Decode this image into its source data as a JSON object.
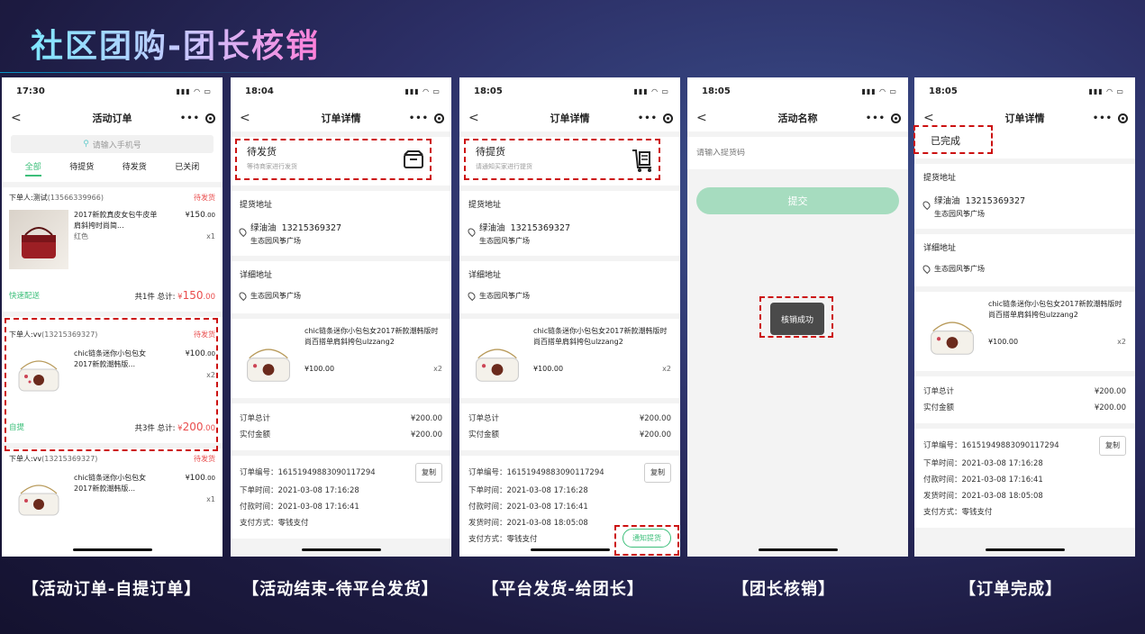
{
  "title": "社区团购-团长核销",
  "captions": [
    "【活动订单-自提订单】",
    "【活动结束-待平台发货】",
    "【平台发货-给团长】",
    "【团长核销】",
    "【订单完成】"
  ],
  "colors": {
    "accent_green": "#3cbf7a",
    "price_red": "#e94c4c",
    "dash_red": "#cc1111"
  },
  "phone1": {
    "time": "17:30",
    "nav_title": "活动订单",
    "search_placeholder": "请输入手机号",
    "tabs": [
      "全部",
      "待提货",
      "待发货",
      "已关闭"
    ],
    "orders": [
      {
        "buyer": "下单人:测试",
        "phone": "(13566339966)",
        "status": "待发货",
        "product": "2017新款真皮女包牛皮单肩斜挎时尚简...",
        "variant": "红色",
        "price_sym": "¥",
        "price_int": "150",
        "price_dec": ".00",
        "qty": "x1",
        "ship": "快速配送",
        "summary": "共1件 总计:",
        "total_sym": "¥",
        "total_int": "150",
        "total_dec": ".00"
      },
      {
        "buyer": "下单人:vv",
        "phone": "(13215369327)",
        "status": "待发货",
        "product": "chic链条迷你小包包女2017新款潮韩版...",
        "variant": "",
        "price_sym": "¥",
        "price_int": "100",
        "price_dec": ".00",
        "qty": "x2",
        "ship": "自提",
        "summary": "共3件 总计:",
        "total_sym": "¥",
        "total_int": "200",
        "total_dec": ".00"
      },
      {
        "buyer": "下单人:vv",
        "phone": "(13215369327)",
        "status": "待发货",
        "product": "chic链条迷你小包包女2017新款潮韩版...",
        "variant": "",
        "price_sym": "¥",
        "price_int": "100",
        "price_dec": ".00",
        "qty": "x1"
      }
    ]
  },
  "phone2": {
    "time": "18:04",
    "nav_title": "订单详情",
    "status_title": "待发货",
    "status_sub": "等待商家进行发货",
    "pickup_label": "提货地址",
    "pickup_name": "绿油油",
    "pickup_phone": "13215369327",
    "pickup_place": "生态园风筝广场",
    "detail_label": "详细地址",
    "detail_place": "生态园风筝广场",
    "product": "chic链条迷你小包包女2017新款潮韩版时尚百搭单肩斜挎包ulzzang2",
    "price": "¥100.00",
    "qty": "x2",
    "order_total_label": "订单总计",
    "order_total": "¥200.00",
    "paid_label": "实付金额",
    "paid": "¥200.00",
    "order_no": "订单编号：16151949883090117294",
    "copy": "复制",
    "order_time": "下单时间：2021-03-08 17:16:28",
    "pay_time": "付款时间：2021-03-08 17:16:41",
    "pay_method": "支付方式：零钱支付"
  },
  "phone3": {
    "time": "18:05",
    "nav_title": "订单详情",
    "status_title": "待提货",
    "status_sub": "请通知买家进行提货",
    "pickup_label": "提货地址",
    "pickup_name": "绿油油",
    "pickup_phone": "13215369327",
    "pickup_place": "生态园风筝广场",
    "detail_label": "详细地址",
    "detail_place": "生态园风筝广场",
    "product": "chic链条迷你小包包女2017新款潮韩版时尚百搭单肩斜挎包ulzzang2",
    "price": "¥100.00",
    "qty": "x2",
    "order_total_label": "订单总计",
    "order_total": "¥200.00",
    "paid_label": "实付金额",
    "paid": "¥200.00",
    "order_no": "订单编号：16151949883090117294",
    "copy": "复制",
    "order_time": "下单时间：2021-03-08 17:16:28",
    "pay_time": "付款时间：2021-03-08 17:16:41",
    "ship_time": "发货时间：2021-03-08 18:05:08",
    "pay_method": "支付方式：零钱支付",
    "notify_button": "通知提货"
  },
  "phone4": {
    "time": "18:05",
    "nav_title": "活动名称",
    "code_placeholder": "请输入提货码",
    "submit": "提交",
    "toast": "核销成功"
  },
  "phone5": {
    "time": "18:05",
    "nav_title": "订单详情",
    "status_title": "已完成",
    "pickup_label": "提货地址",
    "pickup_name": "绿油油",
    "pickup_phone": "13215369327",
    "pickup_place": "生态园风筝广场",
    "detail_label": "详细地址",
    "detail_place": "生态园风筝广场",
    "product": "chic链条迷你小包包女2017新款潮韩版时尚百搭单肩斜挎包ulzzang2",
    "price": "¥100.00",
    "qty": "x2",
    "order_total_label": "订单总计",
    "order_total": "¥200.00",
    "paid_label": "实付金额",
    "paid": "¥200.00",
    "order_no": "订单编号：16151949883090117294",
    "copy": "复制",
    "order_time": "下单时间：2021-03-08 17:16:28",
    "pay_time": "付款时间：2021-03-08 17:16:41",
    "ship_time": "发货时间：2021-03-08 18:05:08",
    "pay_method": "支付方式：零钱支付"
  }
}
